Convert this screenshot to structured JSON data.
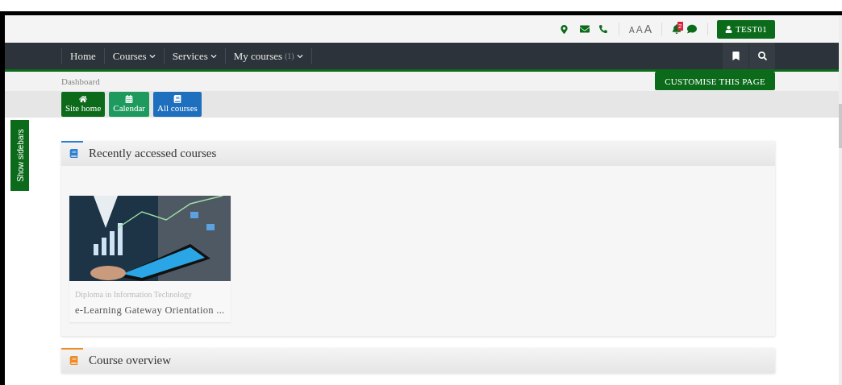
{
  "header": {
    "font_sizes": [
      "A",
      "A",
      "A"
    ],
    "notification_count": "2",
    "user_button": "TEST01"
  },
  "nav": {
    "items": [
      {
        "label": "Home",
        "dropdown": false
      },
      {
        "label": "Courses",
        "dropdown": true
      },
      {
        "label": "Services",
        "dropdown": true
      },
      {
        "label": "My courses",
        "count": "(1)",
        "dropdown": true
      }
    ]
  },
  "breadcrumb": "Dashboard",
  "customise_button": "CUSTOMISE THIS PAGE",
  "quick_links": [
    {
      "label": "Site home",
      "kind": "home",
      "color": "#0b6b1a"
    },
    {
      "label": "Calendar",
      "kind": "calendar",
      "color": "#1f9a5e"
    },
    {
      "label": "All courses",
      "kind": "book",
      "color": "#1f6fbf"
    }
  ],
  "sidebar_toggle": "Show sidebars",
  "blocks": [
    {
      "title": "Recently accessed courses",
      "color": "#2f7fd0",
      "courses": [
        {
          "kind": "picture",
          "category": "Diploma in Information Technology",
          "name": "e-Learning Gateway Orientation ..."
        }
      ]
    },
    {
      "title": "Course overview",
      "color": "#f08a24"
    }
  ]
}
